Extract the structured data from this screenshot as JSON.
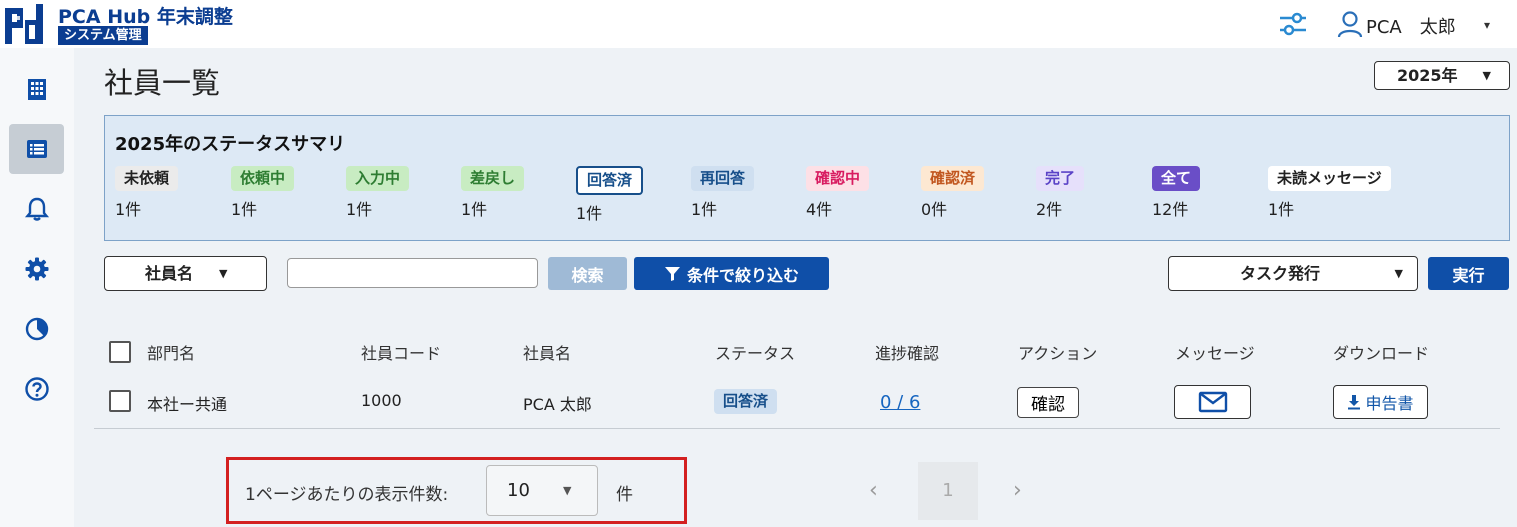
{
  "header": {
    "brand_title": "PCA Hub 年末調整",
    "brand_sub": "システム管理",
    "user_name": "PCA　太郎",
    "caret": "▾"
  },
  "sidebar": {
    "items": [
      {
        "icon": "building-icon"
      },
      {
        "icon": "list-icon",
        "active": true
      },
      {
        "icon": "bell-icon"
      },
      {
        "icon": "gear-icon"
      },
      {
        "icon": "pie-chart-icon"
      },
      {
        "icon": "help-icon"
      }
    ]
  },
  "page": {
    "title": "社員一覧",
    "year": "2025年"
  },
  "summary": {
    "title": "2025年のステータスサマリ",
    "stats": [
      {
        "label": "未依頼",
        "count": "1件"
      },
      {
        "label": "依頼中",
        "count": "1件"
      },
      {
        "label": "入力中",
        "count": "1件"
      },
      {
        "label": "差戻し",
        "count": "1件"
      },
      {
        "label": "回答済",
        "count": "1件"
      },
      {
        "label": "再回答",
        "count": "1件"
      },
      {
        "label": "確認中",
        "count": "4件"
      },
      {
        "label": "確認済",
        "count": "0件"
      },
      {
        "label": "完了",
        "count": "2件"
      },
      {
        "label": "全て",
        "count": "12件"
      },
      {
        "label": "未読メッセージ",
        "count": "1件"
      }
    ]
  },
  "filter": {
    "field": "社員名",
    "search_value": "",
    "search_label": "検索",
    "filter_label": "条件で絞り込む",
    "task": "タスク発行",
    "exec_label": "実行"
  },
  "table": {
    "headers": [
      "部門名",
      "社員コード",
      "社員名",
      "ステータス",
      "進捗確認",
      "アクション",
      "メッセージ",
      "ダウンロード"
    ],
    "rows": [
      {
        "department": "本社ー共通",
        "code": "1000",
        "name": "PCA 太郎",
        "status": "回答済",
        "progress": "0 / 6",
        "action": "確認",
        "download": "申告書"
      }
    ]
  },
  "pagination": {
    "per_page_label": "1ページあたりの表示件数:",
    "per_page_value": "10",
    "unit": "件",
    "current_page": "1",
    "prev": "‹",
    "next": "›"
  },
  "colors": {
    "brand": "#0b3d91",
    "primary_button": "#0f4fa8",
    "highlight": "#d32020"
  }
}
